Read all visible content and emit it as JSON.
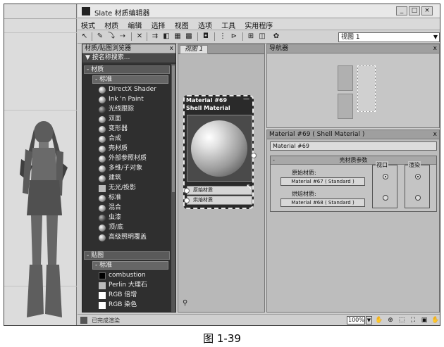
{
  "window": {
    "title": "Slate 材质编辑器",
    "min_icon": "minimize-icon",
    "max_icon": "maximize-icon",
    "close_icon": "close-icon"
  },
  "menu": [
    "模式",
    "材质",
    "编辑",
    "选择",
    "视图",
    "选项",
    "工具",
    "实用程序"
  ],
  "toolbar": {
    "view_selector": "视图 1"
  },
  "browser": {
    "title": "材质/贴图浏览器",
    "close": "x",
    "search_placeholder": "按名称搜索...",
    "materials_group": "- 材质",
    "standard_sub": "- 标准",
    "materials": [
      {
        "label": "DirectX Shader",
        "style": "ball"
      },
      {
        "label": "Ink 'n Paint",
        "style": "ball"
      },
      {
        "label": "光线跟踪",
        "style": "dark"
      },
      {
        "label": "双面",
        "style": "ball"
      },
      {
        "label": "变形器",
        "style": "ball"
      },
      {
        "label": "合成",
        "style": "ball"
      },
      {
        "label": "壳材质",
        "style": "ball"
      },
      {
        "label": "外部参照材质",
        "style": "ball"
      },
      {
        "label": "多维/子对象",
        "style": "ball"
      },
      {
        "label": "建筑",
        "style": "ball"
      },
      {
        "label": "无光/投影",
        "style": "flat"
      },
      {
        "label": "标准",
        "style": "ball"
      },
      {
        "label": "混合",
        "style": "ball"
      },
      {
        "label": "虫漆",
        "style": "dark"
      },
      {
        "label": "顶/底",
        "style": "ball"
      },
      {
        "label": "高级照明覆盖",
        "style": "ball"
      }
    ],
    "maps_group": "- 贴图",
    "maps_standard_sub": "- 标准",
    "maps": [
      {
        "label": "combustion",
        "style": "black"
      },
      {
        "label": "Perlin 大理石",
        "style": "flat"
      },
      {
        "label": "RGB 倍增",
        "style": "white"
      },
      {
        "label": "RGB 染色",
        "style": "white"
      }
    ]
  },
  "view": {
    "tab": "视图 1",
    "node": {
      "title_line1": "Material #69",
      "title_line2": "Shell Material",
      "collapse": "—",
      "slot1": "原始材质",
      "slot2": "烘焙材质"
    }
  },
  "navigator": {
    "title": "导航器",
    "close": "x"
  },
  "params": {
    "title": "Material #69  ( Shell Material )",
    "close": "x",
    "name_value": "Material #69",
    "rollout_title": "壳材质参数",
    "collapse": "-",
    "original_label": "原始材质:",
    "original_value": "Material #67  ( Standard )",
    "baked_label": "烘焙材质:",
    "baked_value": "Material #68  ( Standard )",
    "viewport_label": "视口",
    "render_label": "渲染"
  },
  "status": {
    "text": "已完成渲染",
    "zoom": "100%"
  },
  "caption": "图 1-39"
}
